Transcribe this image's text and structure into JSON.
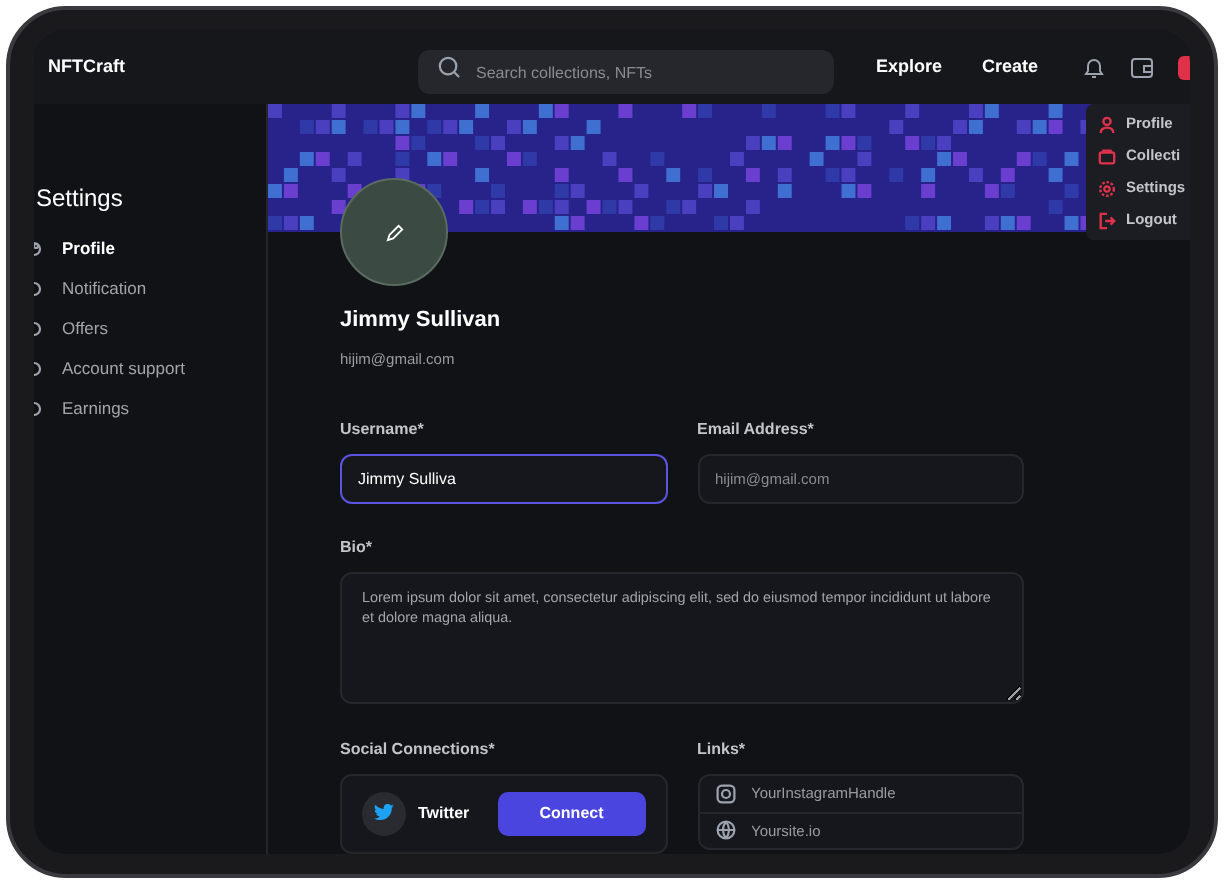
{
  "header": {
    "logo": "NFTCraft",
    "search": {
      "placeholder": "Search collections, NFTs"
    },
    "nav": [
      "Explore",
      "Create"
    ]
  },
  "user_menu": {
    "items": [
      {
        "label": "Profile",
        "kind": "user"
      },
      {
        "label": "Collecti",
        "kind": "wallet"
      },
      {
        "label": "Settings",
        "kind": "gear"
      },
      {
        "label": "Logout",
        "kind": "logout"
      }
    ]
  },
  "sidebar": {
    "title": "Settings",
    "items": [
      {
        "label": "Profile",
        "selected": true
      },
      {
        "label": "Notification",
        "selected": false
      },
      {
        "label": "Offers",
        "selected": false
      },
      {
        "label": "Account support",
        "selected": false
      },
      {
        "label": "Earnings",
        "selected": false
      }
    ]
  },
  "profile": {
    "name": "Jimmy Sullivan",
    "email": "hijim@gmail.com"
  },
  "form": {
    "username": {
      "label": "Username*",
      "value": "Jimmy Sulliva"
    },
    "email": {
      "label": "Email Address*",
      "placeholder": "hijim@gmail.com"
    },
    "bio": {
      "label": "Bio*",
      "value": "Lorem ipsum dolor sit amet, consectetur adipiscing elit, sed do eiusmod tempor incididunt ut labore et dolore magna aliqua."
    },
    "social": {
      "label": "Social Connections*",
      "items": [
        {
          "name": "Twitter",
          "action": "Connect"
        }
      ]
    },
    "links": {
      "label": "Links*",
      "items": [
        {
          "kind": "instagram",
          "placeholder": "YourInstagramHandle"
        },
        {
          "kind": "web",
          "placeholder": "Yoursite.io"
        }
      ]
    }
  }
}
